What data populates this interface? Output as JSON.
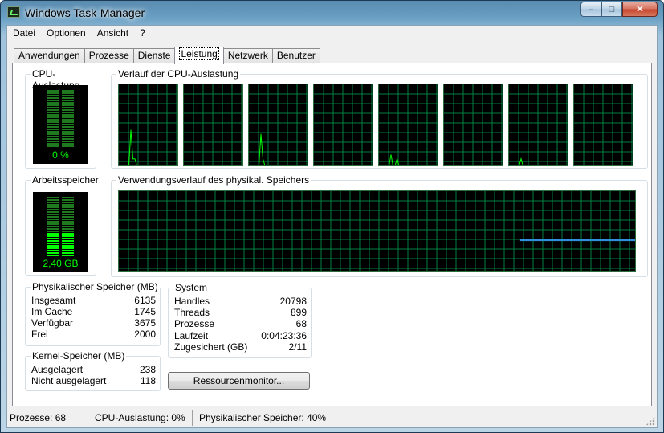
{
  "window": {
    "title": "Windows Task-Manager"
  },
  "menu": {
    "items": [
      {
        "label": "Datei"
      },
      {
        "label": "Optionen"
      },
      {
        "label": "Ansicht"
      },
      {
        "label": "?"
      }
    ]
  },
  "tabs": [
    {
      "label": "Anwendungen"
    },
    {
      "label": "Prozesse"
    },
    {
      "label": "Dienste"
    },
    {
      "label": "Leistung",
      "active": true
    },
    {
      "label": "Netzwerk"
    },
    {
      "label": "Benutzer"
    }
  ],
  "cpu": {
    "label": "CPU-Auslastung",
    "value_text": "0 %",
    "percent": 0
  },
  "cpu_history": {
    "label": "Verlauf der CPU-Auslastung",
    "core_count": 8
  },
  "memory": {
    "label": "Arbeitsspeicher",
    "value_text": "2,40 GB",
    "percent": 40
  },
  "memory_history": {
    "label": "Verwendungsverlauf des physikal. Speichers"
  },
  "physical": {
    "title": "Physikalischer Speicher (MB)",
    "rows": [
      {
        "label": "Insgesamt",
        "value": "6135"
      },
      {
        "label": "Im Cache",
        "value": "1745"
      },
      {
        "label": "Verfügbar",
        "value": "3675"
      },
      {
        "label": "Frei",
        "value": "2000"
      }
    ]
  },
  "kernel": {
    "title": "Kernel-Speicher (MB)",
    "rows": [
      {
        "label": "Ausgelagert",
        "value": "238"
      },
      {
        "label": "Nicht ausgelagert",
        "value": "118"
      }
    ]
  },
  "system": {
    "title": "System",
    "rows": [
      {
        "label": "Handles",
        "value": "20798"
      },
      {
        "label": "Threads",
        "value": "899"
      },
      {
        "label": "Prozesse",
        "value": "68"
      },
      {
        "label": "Laufzeit",
        "value": "0:04:23:36"
      },
      {
        "label": "Zugesichert (GB)",
        "value": "2/11"
      }
    ]
  },
  "resource_button": {
    "label": "Ressourcenmonitor..."
  },
  "status": {
    "processes": "Prozesse: 68",
    "cpu": "CPU-Auslastung: 0%",
    "memory": "Physikalischer Speicher: 40%"
  },
  "colors": {
    "graph_bg": "#000000",
    "grid": "#008040",
    "cpu_line": "#00ff00",
    "mem_line": "#2f8fdc"
  }
}
